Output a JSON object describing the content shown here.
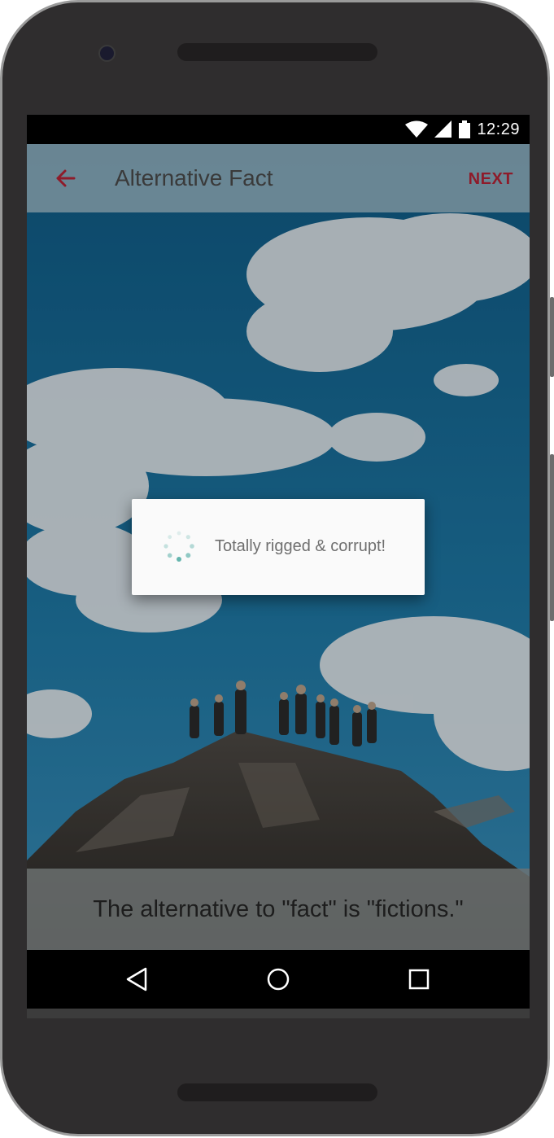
{
  "status_bar": {
    "time": "12:29",
    "icons": [
      "wifi-icon",
      "signal-icon",
      "battery-icon"
    ]
  },
  "app_bar": {
    "title": "Alternative Fact",
    "next_label": "NEXT",
    "back_icon": "arrow-left-icon",
    "accent_color": "#8e1b2a"
  },
  "dialog": {
    "message": "Totally rigged & corrupt!",
    "spinner_icon": "loading-spinner-icon"
  },
  "caption": {
    "text": "The alternative to \"fact\" is \"fictions.\""
  },
  "nav_bar": {
    "icons": [
      "back-triangle-icon",
      "home-circle-icon",
      "recents-square-icon"
    ]
  }
}
